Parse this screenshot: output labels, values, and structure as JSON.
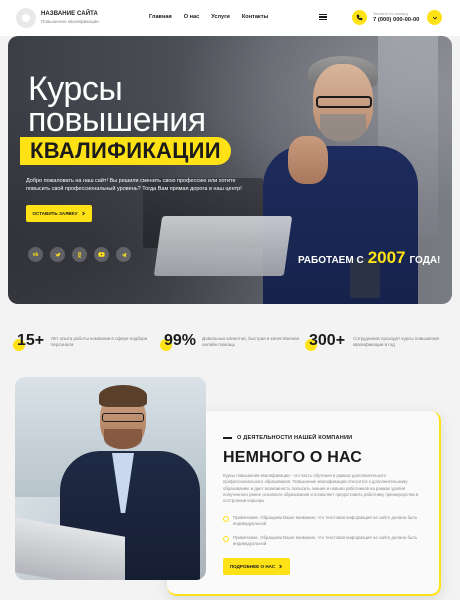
{
  "header": {
    "site_name": "НАЗВАНИЕ САЙТА",
    "site_sub": "Повышение квалификации",
    "nav": [
      "Главная",
      "О нас",
      "Услуги",
      "Контакты"
    ],
    "phone_label": "Звоните по номеру",
    "phone": "7 (000) 000-00-00",
    "icons": {
      "menu": "menu-icon",
      "phone": "phone-icon",
      "chevron": "chevron-down-icon"
    }
  },
  "hero": {
    "title_line1": "Курсы",
    "title_line2": "повышения",
    "highlight": "КВАЛИФИКАЦИИ",
    "text": "Добро пожаловать на наш сайт! Вы решили сменить свою профессию или хотите повысить свой профессиональный уровень? Тогда Вам прямая дорога в наш центр!",
    "button": "ОСТАВИТЬ ЗАЯВКУ",
    "socials": [
      "vk",
      "tw",
      "ok",
      "yt",
      "tg"
    ],
    "works_prefix": "РАБОТАЕМ С",
    "works_year": "2007",
    "works_suffix": "ГОДА!"
  },
  "stats": [
    {
      "num": "15+",
      "text": "Лет опыта работы компании в сфере подбора персонала"
    },
    {
      "num": "99%",
      "text": "Довольных клиентов, быстрая и качественная онлайн помощь"
    },
    {
      "num": "300+",
      "text": "Сотрудников проходят курсы повышения квалификации в год"
    }
  ],
  "about": {
    "kicker": "О ДЕЯТЕЛЬНОСТИ НАШЕЙ КОМПАНИИ",
    "title": "НЕМНОГО О НАС",
    "text": "Курсы повышения квалификации - это часть обучения в рамках дополнительного профессионального образования. Повышение квалификации относится к дополнительному образованию и дает возможность повысить знания и навыки работников на рамках уровня полученного ранее основного образования и позволяет предоставить работнику преимущества в построении карьеры.",
    "notes": [
      "Примечание. Обращаем Ваше внимание, что текстовая информация на сайте должна быть индивидуальной",
      "Примечание. Обращаем Ваше внимание, что текстовая информация на сайте должна быть индивидуальной"
    ],
    "button": "ПОДРОБНЕЕ О НАС"
  },
  "colors": {
    "accent": "#ffe216",
    "text": "#1b1b1b",
    "muted": "#8a8a8a"
  }
}
